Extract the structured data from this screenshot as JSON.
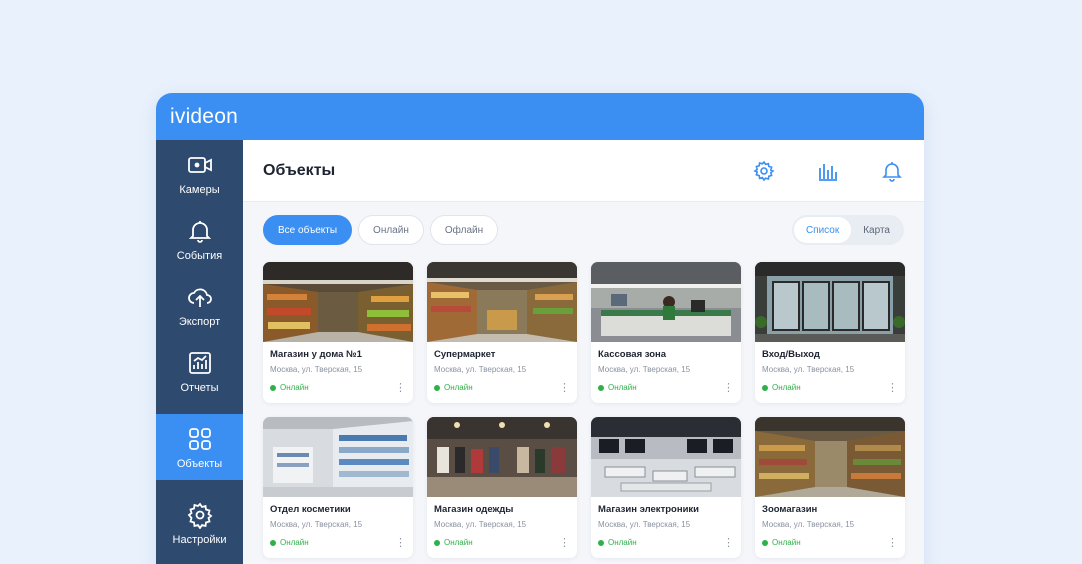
{
  "app": {
    "logo": "ivideon"
  },
  "sidebar": {
    "items": [
      {
        "label": "Камеры",
        "icon": "camera-icon"
      },
      {
        "label": "События",
        "icon": "bell-icon"
      },
      {
        "label": "Экспорт",
        "icon": "cloud-upload-icon"
      },
      {
        "label": "Отчеты",
        "icon": "chart-icon"
      },
      {
        "label": "Объекты",
        "icon": "grid-objects-icon"
      },
      {
        "label": "Настройки",
        "icon": "gear-icon"
      }
    ],
    "active": "Объекты"
  },
  "header": {
    "title": "Объекты",
    "icons": [
      "settings-icon",
      "analytics-icon",
      "notification-icon"
    ]
  },
  "filters": {
    "options": [
      "Все объекты",
      "Онлайн",
      "Офлайн"
    ],
    "selected": "Все объекты"
  },
  "view_toggle": {
    "options": [
      "Список",
      "Карта"
    ],
    "selected": "Список"
  },
  "objects": [
    {
      "title": "Магазин у дома №1",
      "address": "Москва, ул. Тверская, 15",
      "status": "Онлайн"
    },
    {
      "title": "Супермаркет",
      "address": "Москва, ул. Тверская, 15",
      "status": "Онлайн"
    },
    {
      "title": "Кассовая зона",
      "address": "Москва, ул. Тверская, 15",
      "status": "Онлайн"
    },
    {
      "title": "Вход/Выход",
      "address": "Москва, ул. Тверская, 15",
      "status": "Онлайн"
    },
    {
      "title": "Отдел косметики",
      "address": "Москва, ул. Тверская, 15",
      "status": "Онлайн"
    },
    {
      "title": "Магазин одежды",
      "address": "Москва, ул. Тверская, 15",
      "status": "Онлайн"
    },
    {
      "title": "Магазин электроники",
      "address": "Москва, ул. Тверская, 15",
      "status": "Онлайн"
    },
    {
      "title": "Зоомагазин",
      "address": "Москва, ул. Тверская, 15",
      "status": "Онлайн"
    }
  ],
  "colors": {
    "accent": "#3b8ff2",
    "sidebar": "#2e4a6e",
    "online": "#2fb14a"
  }
}
